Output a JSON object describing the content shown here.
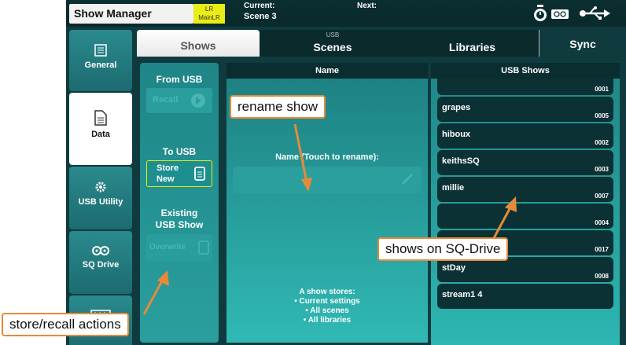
{
  "topbar": {
    "title": "Show Manager",
    "mix_line1": "LR",
    "mix_line2": "MainLR",
    "current_label": "Current:",
    "current_value": "Scene 3",
    "next_label": "Next:"
  },
  "sidebar": {
    "items": [
      {
        "label": "General",
        "icon": "list-icon"
      },
      {
        "label": "Data",
        "icon": "usb-file-icon"
      },
      {
        "label": "USB Utility",
        "icon": "gear-icon"
      },
      {
        "label": "SQ Drive",
        "icon": "sq-drive-icon"
      },
      {
        "label": "",
        "icon": "meter-icon"
      }
    ]
  },
  "tabs": {
    "shows": "Shows",
    "usb_caption": "USB",
    "scenes": "Scenes",
    "libraries": "Libraries",
    "sync": "Sync"
  },
  "actions": {
    "from_usb": "From USB",
    "recall": "Recall",
    "to_usb": "To USB",
    "store_new_1": "Store",
    "store_new_2": "New",
    "existing_1": "Existing",
    "existing_2": "USB Show",
    "overwrite": "Overwrite"
  },
  "name_panel": {
    "header": "Name",
    "field_label": "Name (Touch to rename):",
    "info_title": "A show stores:",
    "info_items": [
      "• Current settings",
      "• All scenes",
      "• All libraries"
    ]
  },
  "usb_shows": {
    "header": "USB Shows",
    "items": [
      {
        "name": "",
        "number": "0001"
      },
      {
        "name": "grapes",
        "number": "0005"
      },
      {
        "name": "hiboux",
        "number": "0002"
      },
      {
        "name": "keithsSQ",
        "number": "0003"
      },
      {
        "name": "millie",
        "number": "0007"
      },
      {
        "name": "",
        "number": "0004"
      },
      {
        "name": "",
        "number": "0017"
      },
      {
        "name": "stDay",
        "number": "0008"
      },
      {
        "name": "stream1 4",
        "number": ""
      }
    ]
  },
  "callouts": {
    "rename": "rename show",
    "shows_on_drive": "shows on SQ-Drive",
    "store_recall": "store/recall actions"
  },
  "colors": {
    "accent_orange": "#e58a3b",
    "mix_badge_yellow": "#e9ec15",
    "app_dark": "#0f3b3f"
  }
}
